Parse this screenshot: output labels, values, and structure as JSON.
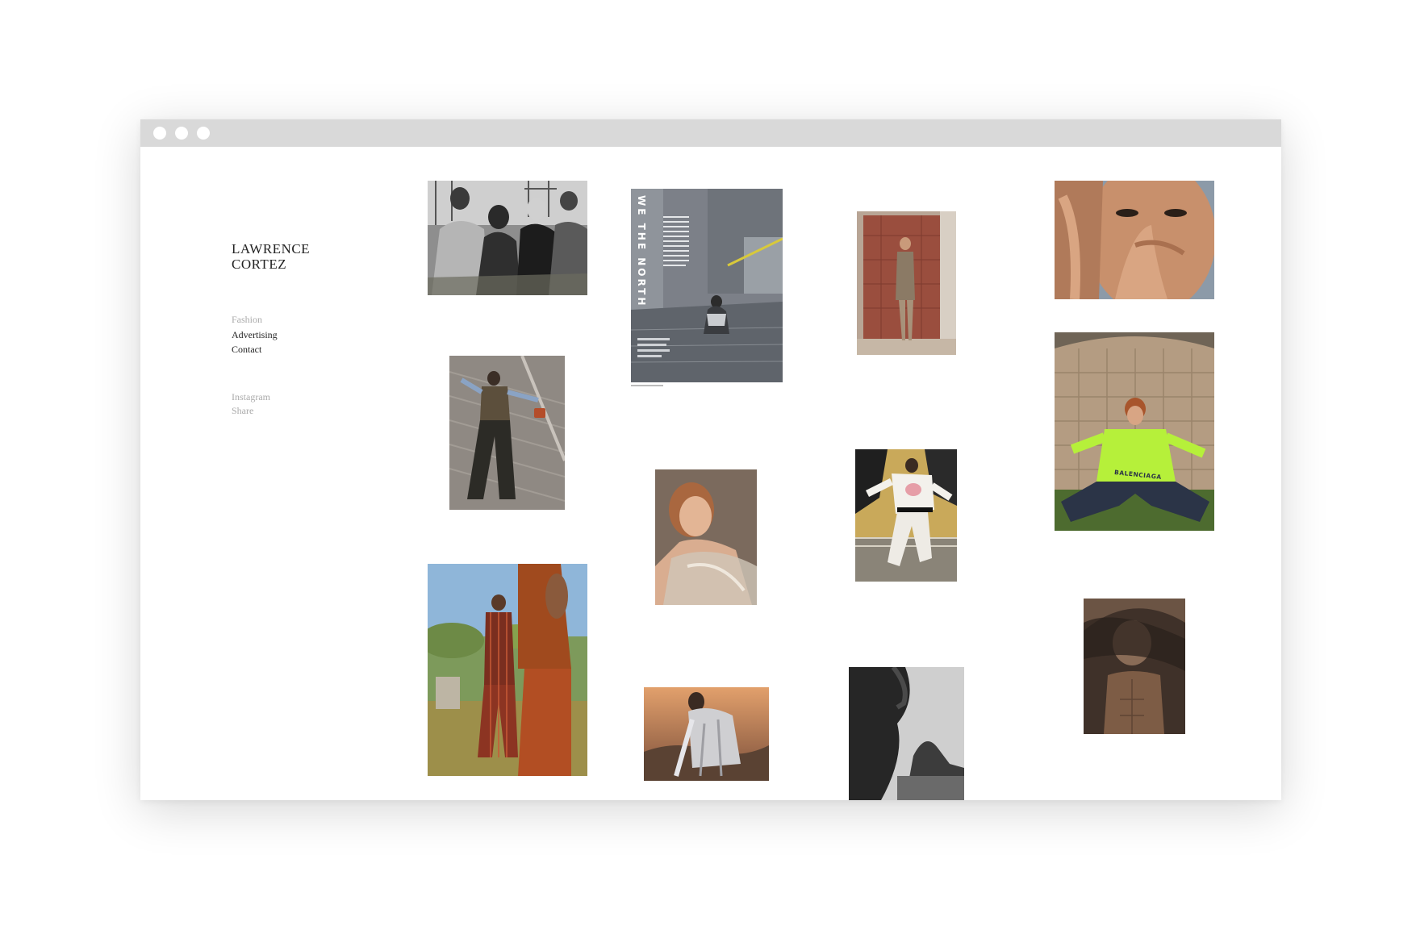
{
  "site": {
    "title": "LAWRENCE\nCORTEZ"
  },
  "nav": {
    "items": [
      {
        "label": "Fashion"
      },
      {
        "label": "Advertising"
      },
      {
        "label": "Contact"
      }
    ]
  },
  "social": {
    "items": [
      {
        "label": "Instagram"
      },
      {
        "label": "Share"
      }
    ]
  },
  "gallery": {
    "magazine_headline": "WE THE NORTH",
    "jacket_logo": "BALENCIAGA"
  }
}
